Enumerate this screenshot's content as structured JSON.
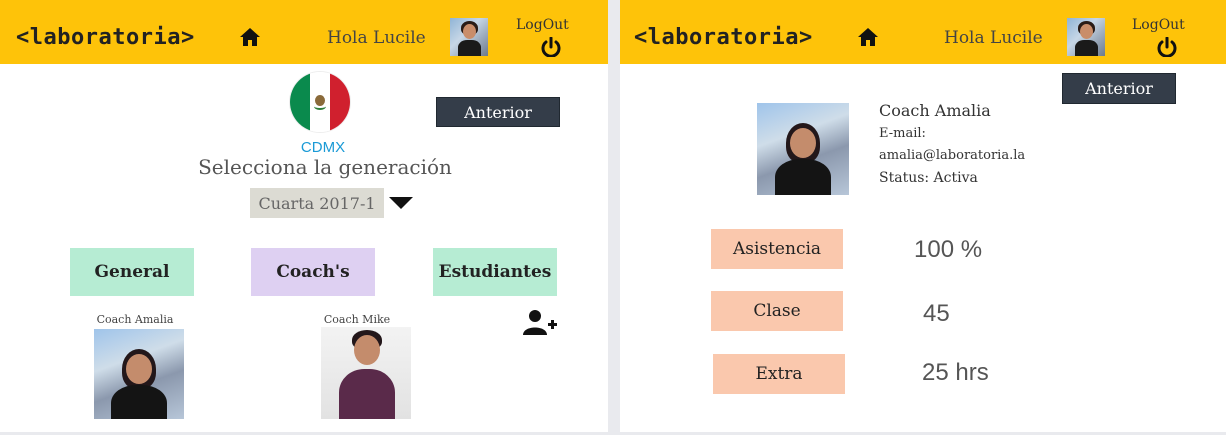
{
  "header": {
    "logo": "<laboratoria>",
    "greeting": "Hola Lucile",
    "logout": "LogOut"
  },
  "left": {
    "city": "CDMX",
    "prev_button": "Anterior",
    "generation_title": "Selecciona la generación",
    "generation_selected": "Cuarta 2017-1",
    "tabs": [
      "General",
      "Coach's",
      "Estudiantes"
    ],
    "coaches": [
      {
        "name": "Coach Amalia"
      },
      {
        "name": "Coach Mike"
      }
    ]
  },
  "right": {
    "prev_button": "Anterior",
    "coach": {
      "name": "Coach Amalia",
      "email_label": "E-mail:",
      "email": "amalia@laboratoria.la",
      "status": "Status: Activa"
    },
    "stats": [
      {
        "label": "Asistencia",
        "value": "100 %"
      },
      {
        "label": "Clase",
        "value": "45"
      },
      {
        "label": "Extra",
        "value": "25 hrs"
      }
    ]
  },
  "icons": [
    "home-icon",
    "power-icon",
    "chevron-down-icon",
    "add-user-icon",
    "flag-mexico-icon"
  ],
  "colors": {
    "header": "#fec309",
    "prev_button": "#343d49",
    "tab_green": "#b6ecd3",
    "tab_purple": "#ded0f2",
    "stat_label": "#fac8ad",
    "city": "#1a9ad6"
  }
}
